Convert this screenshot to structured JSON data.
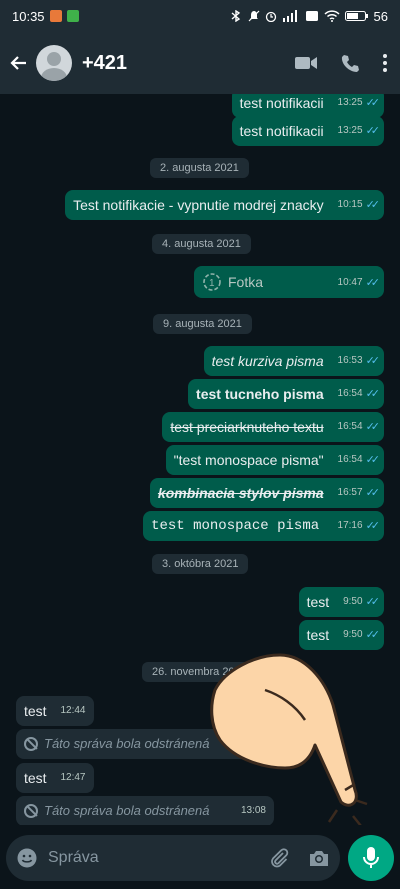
{
  "status_bar": {
    "time": "10:35",
    "battery": "56"
  },
  "header": {
    "contact_name": "+421"
  },
  "messages": [
    {
      "type": "out",
      "text": "test notifikacii",
      "time": "13:25"
    },
    {
      "type": "out",
      "text": "test notifikacii",
      "time": "13:25"
    },
    {
      "type": "date",
      "text": "2. augusta 2021"
    },
    {
      "type": "out",
      "text": "Test notifikacie - vypnutie modrej znacky",
      "time": "10:15"
    },
    {
      "type": "date",
      "text": "4. augusta 2021"
    },
    {
      "type": "out",
      "text": "Fotka",
      "time": "10:47"
    },
    {
      "type": "date",
      "text": "9. augusta 2021"
    },
    {
      "type": "out",
      "text": "test kurziva pisma",
      "time": "16:53"
    },
    {
      "type": "out",
      "text": "test tucneho pisma",
      "time": "16:54"
    },
    {
      "type": "out",
      "text": "test preciarknuteho textu",
      "time": "16:54"
    },
    {
      "type": "out",
      "text": "\"test monospace pisma\"",
      "time": "16:54"
    },
    {
      "type": "out",
      "text": "kombinacia stylov pisma",
      "time": "16:57"
    },
    {
      "type": "out",
      "text": "test monospace pisma",
      "time": "17:16"
    },
    {
      "type": "date",
      "text": "3. októbra 2021"
    },
    {
      "type": "out",
      "text": "test",
      "time": "9:50"
    },
    {
      "type": "out",
      "text": "test",
      "time": "9:50"
    },
    {
      "type": "date",
      "text": "26. novembra 2021"
    },
    {
      "type": "in",
      "text": "test",
      "time": "12:44"
    },
    {
      "type": "in_deleted",
      "text": "Táto správa bola odstránená"
    },
    {
      "type": "in",
      "text": "test",
      "time": "12:47"
    },
    {
      "type": "in_deleted",
      "text": "Táto správa bola odstránená",
      "time": "13:08"
    }
  ],
  "input": {
    "placeholder": "Správa"
  },
  "colors": {
    "accent": "#00a884",
    "outgoing_bubble": "#005c4b",
    "incoming_bubble": "#1f2c34",
    "read_ticks": "#53bdeb"
  }
}
